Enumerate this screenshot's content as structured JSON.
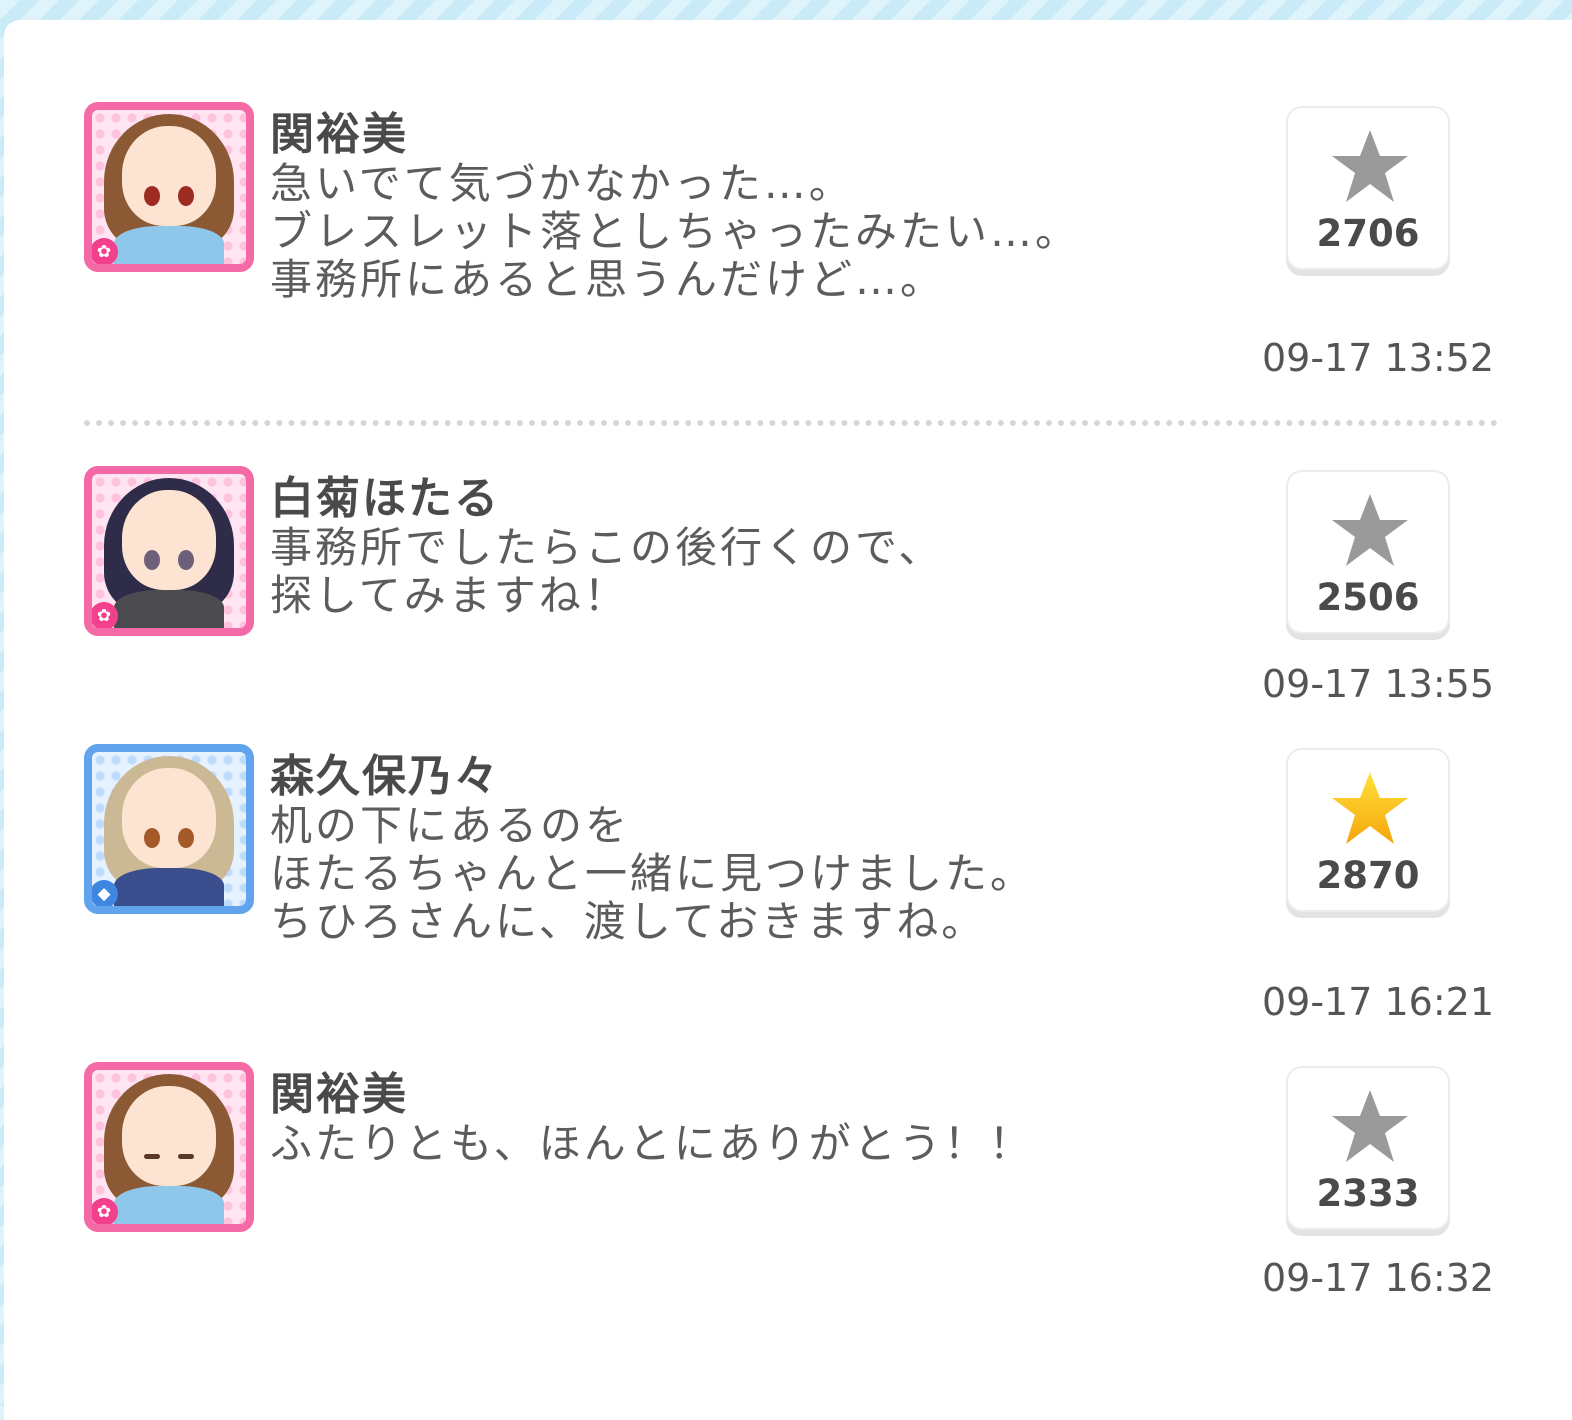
{
  "posts": [
    {
      "name": "関裕美",
      "message": "急いでて気づかなかった…。\nブレスレット落としちゃったみたい…。\n事務所にあると思うんだけど…。",
      "likes": "2706",
      "time": "09-17 13:52",
      "liked": false,
      "avatar_theme": "pink",
      "badge_icon": "flower-icon"
    },
    {
      "name": "白菊ほたる",
      "message": "事務所でしたらこの後行くので、\n探してみますね！",
      "likes": "2506",
      "time": "09-17 13:55",
      "liked": false,
      "avatar_theme": "pink",
      "badge_icon": "flower-icon"
    },
    {
      "name": "森久保乃々",
      "message": "机の下にあるのを\nほたるちゃんと一緒に見つけました。\nちひろさんに、渡しておきますね。",
      "likes": "2870",
      "time": "09-17 16:21",
      "liked": true,
      "avatar_theme": "blue",
      "badge_icon": "diamond-icon"
    },
    {
      "name": "関裕美",
      "message": "ふたりとも、ほんとにありがとう！！",
      "likes": "2333",
      "time": "09-17 16:32",
      "liked": false,
      "avatar_theme": "pink",
      "badge_icon": "flower-icon"
    }
  ],
  "colors": {
    "star_inactive": "#9a9a9a",
    "star_active": "#f8b90f",
    "pink_frame": "#f36aa7",
    "blue_frame": "#62a3ee"
  }
}
